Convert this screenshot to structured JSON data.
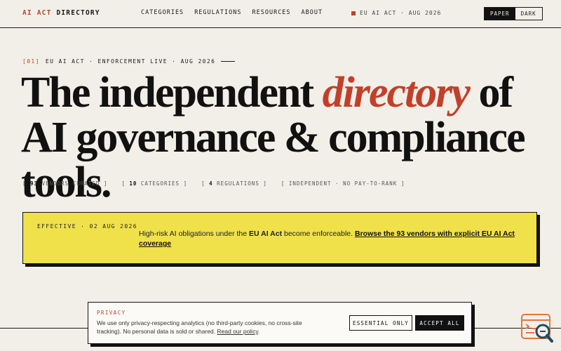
{
  "header": {
    "logo_accent": "AI ACT",
    "logo_rest": "DIRECTORY",
    "nav": [
      "CATEGORIES",
      "REGULATIONS",
      "RESOURCES",
      "ABOUT"
    ],
    "status": "EU AI ACT · AUG 2026",
    "theme_toggle": {
      "paper": "PAPER",
      "dark": "DARK",
      "selected": "PAPER"
    }
  },
  "hero": {
    "eyebrow_index": "[01]",
    "eyebrow_text": "EU AI ACT · ENFORCEMENT LIVE · AUG 2026",
    "headline_pre": "The independent ",
    "headline_em": "directory",
    "headline_post": " of AI governance & compliance tools."
  },
  "stats": [
    {
      "num": "93",
      "label": "VENDORS CURATED"
    },
    {
      "num": "10",
      "label": "CATEGORIES"
    },
    {
      "num": "4",
      "label": "REGULATIONS"
    },
    {
      "num": "",
      "label": "INDEPENDENT · NO PAY-TO-RANK"
    }
  ],
  "banner": {
    "label": "EFFECTIVE · 02 AUG 2026",
    "msg_pre": "High-risk AI obligations under the ",
    "msg_bold": "EU AI Act",
    "msg_mid": " become enforceable. ",
    "msg_link": "Browse the 93 vendors with explicit EU AI Act coverage"
  },
  "cookie": {
    "title": "PRIVACY",
    "text": "We use only privacy-respecting analytics (no third-party cookies, no cross-site tracking). No personal data is sold or shared. ",
    "link": "Read our policy",
    "text_end": ".",
    "essential_label": "ESSENTIAL ONLY",
    "accept_label": "ACCEPT ALL"
  },
  "widget": {
    "icon": "search-doc-icon",
    "color": "#e8743b"
  },
  "colors": {
    "accent": "#c2402a",
    "banner": "#f0e04a",
    "bg": "#f2efe8",
    "ink": "#111111"
  }
}
